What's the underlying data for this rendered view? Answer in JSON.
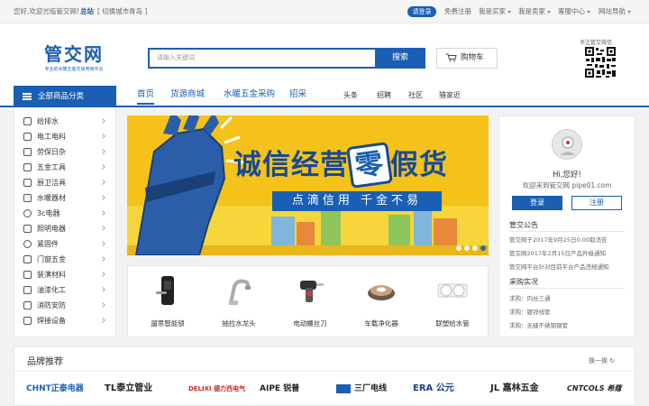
{
  "topbar": {
    "greeting": "您好,欢迎光临管交网!",
    "site": "总站",
    "switch_city": "[ 切换城市",
    "city": "青岛 ]",
    "login": "请登录",
    "register": "免费注册",
    "buyer": "我是买家",
    "seller": "我是卖家",
    "service": "客服中心",
    "site_nav": "网站导航"
  },
  "header": {
    "logo": "管交网",
    "logo_sub": "专业的水暖五金交易电商平台",
    "search_placeholder": "请输入关键词",
    "search_button": "搜索",
    "cart": "购物车",
    "qr_label": "关注管交微信"
  },
  "nav": {
    "all_categories": "全部商品分类",
    "main": [
      "首页",
      "货源商城",
      "水暖五金采购",
      "招采"
    ],
    "sub": [
      "头条",
      "招聘",
      "社区",
      "猎家近"
    ]
  },
  "sidebar": {
    "items": [
      "给排水",
      "电工电料",
      "劳保日杂",
      "五金工具",
      "厨卫洁具",
      "水暖器材",
      "3c电器",
      "照明电器",
      "紧固件",
      "门窗五金",
      "装潢材料",
      "油漆化工",
      "消防安防",
      "焊接设备"
    ]
  },
  "banner": {
    "title_left": "诚信经营",
    "title_zero": "零",
    "title_right": "假货",
    "slogan": "点滴信用 千金不易"
  },
  "products": [
    "遛思智能锁",
    "抽拉水龙头",
    "电动螺丝刀",
    "车载净化器",
    "联塑给水管"
  ],
  "user": {
    "hello": "Hi,您好!",
    "welcome": "欢迎来到管交网 pipe01.com",
    "login": "登录",
    "register": "注册",
    "notice_title": "管交公告",
    "notices": [
      "管交网于2017年9月25日0:00取消告",
      "管交网2017年2月15日产品升级通知",
      "管交网平台针对目前平台产品违规通知"
    ],
    "purchase_title": "采购实况",
    "purchases": [
      "求购：内丝三通",
      "求购：镀锌线管",
      "求购：无缝不锈钢钢管"
    ]
  },
  "brands": {
    "title": "品牌推荐",
    "refresh": "换一换",
    "items": [
      "CHNT正泰电器",
      "TL泰立管业",
      "DELIXI 德力西电气",
      "AIPE 锐普",
      "三厂电线",
      "ERA 公元",
      "JL 嘉林五金",
      "CNTCOLS 希蔻"
    ]
  },
  "colors": {
    "brand_blue": "#1a5fb4",
    "banner_yellow": "#f5c219"
  }
}
